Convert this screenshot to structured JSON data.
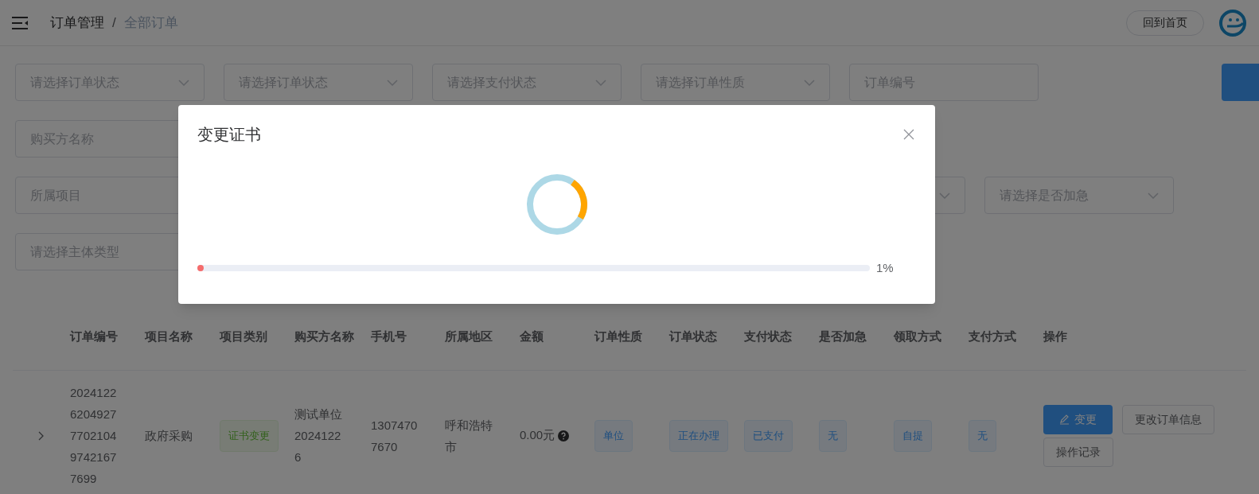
{
  "header": {
    "breadcrumb": [
      {
        "label": "订单管理",
        "current": false
      },
      {
        "label": "全部订单",
        "current": true
      }
    ],
    "separator": "/",
    "home_button": "回到首页"
  },
  "filters": [
    [
      {
        "kind": "select",
        "placeholder": "请选择订单状态"
      },
      {
        "kind": "select",
        "placeholder": "请选择订单状态"
      },
      {
        "kind": "select",
        "placeholder": "请选择支付状态"
      },
      {
        "kind": "select",
        "placeholder": "请选择订单性质"
      },
      {
        "kind": "input",
        "placeholder": "订单编号"
      },
      {
        "kind": "button"
      }
    ],
    [
      {
        "kind": "input",
        "placeholder": "购买方名称"
      }
    ],
    [
      {
        "kind": "input",
        "placeholder": "所属项目"
      },
      {
        "kind": "select"
      },
      {
        "kind": "select",
        "placeholder": "请选择是否加急"
      }
    ],
    [
      {
        "kind": "input",
        "placeholder": "请选择主体类型"
      }
    ]
  ],
  "dialog": {
    "title": "变更证书",
    "progress": {
      "level": 0.01,
      "reading": "1%"
    }
  },
  "table": {
    "columns": [
      "订单编号",
      "项目名称",
      "项目类别",
      "购买方名称",
      "手机号",
      "所属地区",
      "金额",
      "订单性质",
      "订单状态",
      "支付状态",
      "是否加急",
      "领取方式",
      "支付方式",
      "操作"
    ],
    "rows": [
      {
        "expanded": false,
        "cells": [
          {
            "kind": "number",
            "text": "20241226204927770210497421677699"
          },
          {
            "kind": "text",
            "text": "政府采购"
          },
          {
            "kind": "success",
            "text": "证书变更"
          },
          {
            "kind": "text",
            "text": "测试单位20241226"
          },
          {
            "kind": "number",
            "text": "13074707670"
          },
          {
            "kind": "text",
            "text": "呼和浩特市"
          },
          {
            "kind": "amount",
            "text": "0.00元"
          },
          {
            "kind": "primary",
            "text": "单位"
          },
          {
            "kind": "primary",
            "text": "正在办理"
          },
          {
            "kind": "primary",
            "text": "已支付"
          },
          {
            "kind": "primary",
            "text": "无"
          },
          {
            "kind": "primary",
            "text": "自提"
          },
          {
            "kind": "primary",
            "text": "无"
          },
          {
            "kind": "actions",
            "buttons": [
              {
                "kind": "primary",
                "label": "变更"
              },
              {
                "kind": "default",
                "label": "更改订单信息"
              },
              {
                "kind": "default",
                "label": "操作记录"
              }
            ]
          }
        ]
      }
    ]
  }
}
